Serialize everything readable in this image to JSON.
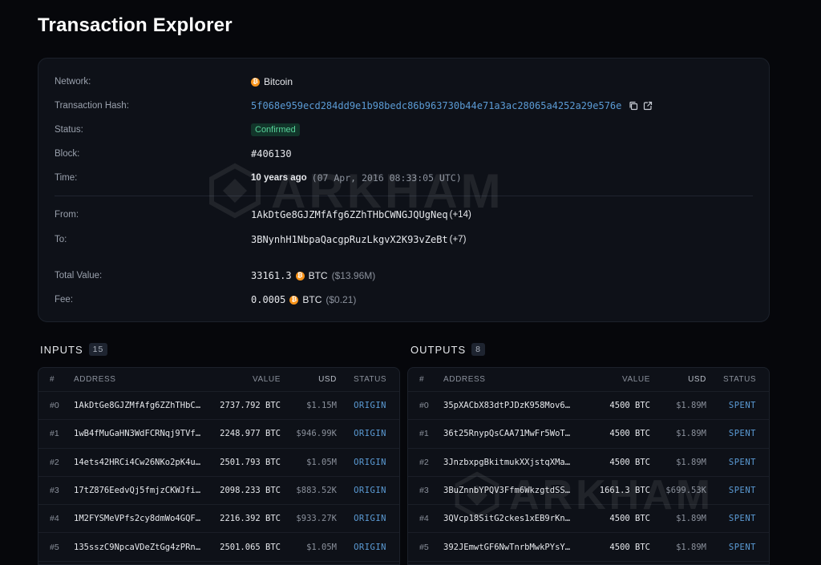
{
  "page": {
    "title": "Transaction Explorer"
  },
  "summary": {
    "network": {
      "label": "Network:",
      "value": "Bitcoin"
    },
    "hash": {
      "label": "Transaction Hash:",
      "value": "5f068e959ecd284dd9e1b98bedc86b963730b44e71a3ac28065a4252a29e576e"
    },
    "status": {
      "label": "Status:",
      "value": "Confirmed"
    },
    "block": {
      "label": "Block:",
      "value": "#406130"
    },
    "time": {
      "label": "Time:",
      "ago": "10 years ago",
      "full": "(07 Apr, 2016 08:33:05 UTC)"
    },
    "from": {
      "label": "From:",
      "address": "1AkDtGe8GJZMfAfg6ZZhTHbCWNGJQUgNeq",
      "extra": "(+14)"
    },
    "to": {
      "label": "To:",
      "address": "3BNynhH1NbpaQacgpRuzLkgvX2K93vZeBt",
      "extra": "(+7)"
    },
    "total_value": {
      "label": "Total Value:",
      "amount": "33161.3",
      "unit": "BTC",
      "usd": "($13.96M)"
    },
    "fee": {
      "label": "Fee:",
      "amount": "0.0005",
      "unit": "BTC",
      "usd": "($0.21)"
    }
  },
  "watermark": "ARKHAM",
  "columns": {
    "idx": "#",
    "address": "ADDRESS",
    "value": "VALUE",
    "usd": "USD",
    "status": "STATUS"
  },
  "inputs": {
    "title": "INPUTS",
    "count": "15",
    "rows": [
      {
        "idx": "#0",
        "address": "1AkDtGe8GJZMfAfg6ZZhTHbC…",
        "value": "2737.792 BTC",
        "usd": "$1.15M",
        "status": "ORIGIN"
      },
      {
        "idx": "#1",
        "address": "1wB4fMuGaHN3WdFCRNqj9TVf…",
        "value": "2248.977 BTC",
        "usd": "$946.99K",
        "status": "ORIGIN"
      },
      {
        "idx": "#2",
        "address": "14ets42HRCi4Cw26NKo2pK4u…",
        "value": "2501.793 BTC",
        "usd": "$1.05M",
        "status": "ORIGIN"
      },
      {
        "idx": "#3",
        "address": "17tZ876EedvQj5fmjzCKWJfi…",
        "value": "2098.233 BTC",
        "usd": "$883.52K",
        "status": "ORIGIN"
      },
      {
        "idx": "#4",
        "address": "1M2FYSMeVPfs2cy8dmWo4GQF…",
        "value": "2216.392 BTC",
        "usd": "$933.27K",
        "status": "ORIGIN"
      },
      {
        "idx": "#5",
        "address": "135sszC9NpcaVDeZtGg4zPRn…",
        "value": "2501.065 BTC",
        "usd": "$1.05M",
        "status": "ORIGIN"
      }
    ]
  },
  "outputs": {
    "title": "OUTPUTS",
    "count": "8",
    "rows": [
      {
        "idx": "#0",
        "address": "35pXACbX83dtPJDzK958Mov6T5q…",
        "value": "4500 BTC",
        "usd": "$1.89M",
        "status": "SPENT"
      },
      {
        "idx": "#1",
        "address": "36t25RnypQsCAA71MwFr5WoTaJw…",
        "value": "4500 BTC",
        "usd": "$1.89M",
        "status": "SPENT"
      },
      {
        "idx": "#2",
        "address": "3JnzbxpgBkitmukXXjstqXManY1…",
        "value": "4500 BTC",
        "usd": "$1.89M",
        "status": "SPENT"
      },
      {
        "idx": "#3",
        "address": "3BuZnnbYPQV3Ffm6WkzgtdSSAEm…",
        "value": "1661.3 BTC",
        "usd": "$699.53K",
        "status": "SPENT"
      },
      {
        "idx": "#4",
        "address": "3QVcp18SitG2ckes1xEB9rKnEPt…",
        "value": "4500 BTC",
        "usd": "$1.89M",
        "status": "SPENT"
      },
      {
        "idx": "#5",
        "address": "392JEmwtGF6NwTnrbMwkPYsYXzg…",
        "value": "4500 BTC",
        "usd": "$1.89M",
        "status": "SPENT"
      }
    ]
  },
  "colors": {
    "accent": "#5b9bd5",
    "bitcoin": "#f7931a",
    "confirmed": "#57d49a",
    "background": "#06070b"
  }
}
